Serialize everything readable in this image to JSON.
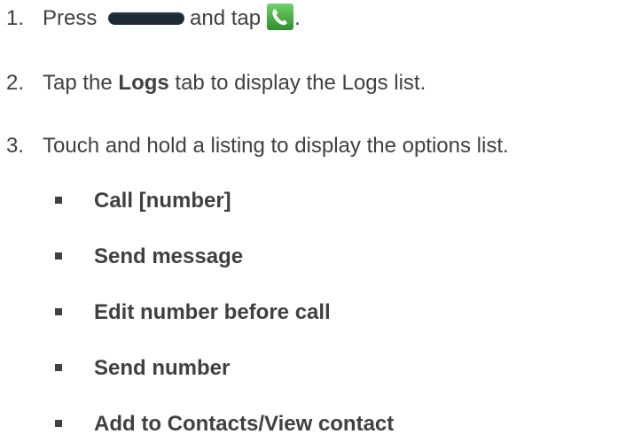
{
  "steps": [
    {
      "number": "1.",
      "text_before": "Press",
      "text_middle": "and tap",
      "text_after": ".",
      "home_key_icon": "home-key-icon",
      "phone_icon": "phone-app-icon"
    },
    {
      "number": "2.",
      "text_before": "Tap the",
      "bold": "Logs",
      "text_after": "tab to display the Logs list."
    },
    {
      "number": "3.",
      "text": "Touch and hold a listing to display the options list."
    }
  ],
  "options": [
    "Call [number]",
    "Send message",
    "Edit number before call",
    "Send number",
    "Add to Contacts/View contact"
  ],
  "colors": {
    "text": "#404040",
    "phone_icon_bg": "#3aa63a",
    "home_key": "#1c2a33"
  }
}
